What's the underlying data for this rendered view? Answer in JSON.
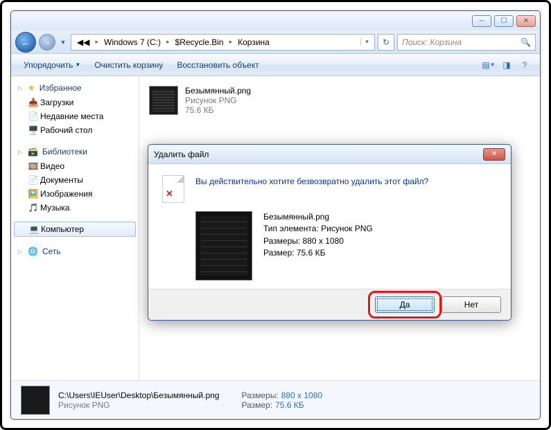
{
  "titlebar": {},
  "nav": {
    "crumbs": [
      "Windows 7 (C:)",
      "$Recycle.Bin",
      "Корзина"
    ],
    "search_placeholder": "Поиск: Корзина"
  },
  "toolbar": {
    "organize": "Упорядочить",
    "empty": "Очистить корзину",
    "restore": "Восстановить объект"
  },
  "sidebar": {
    "favorites": {
      "label": "Избранное",
      "items": [
        "Загрузки",
        "Недавние места",
        "Рабочий стол"
      ]
    },
    "libraries": {
      "label": "Библиотеки",
      "items": [
        "Видео",
        "Документы",
        "Изображения",
        "Музыка"
      ]
    },
    "computer": "Компьютер",
    "network": "Сеть"
  },
  "file": {
    "name": "Безымянный.png",
    "type": "Рисунок PNG",
    "size": "75.6 КБ"
  },
  "details": {
    "path": "C:\\Users\\IEUser\\Desktop\\Безымянный.png",
    "type": "Рисунок PNG",
    "dims_label": "Размеры:",
    "dims": "880 x 1080",
    "size_label": "Размер:",
    "size": "75.6 КБ"
  },
  "dialog": {
    "title": "Удалить файл",
    "question": "Вы действительно хотите безвозвратно удалить этот файл?",
    "file_name": "Безымянный.png",
    "type_line": "Тип элемента: Рисунок PNG",
    "dims_line": "Размеры: 880 x 1080",
    "size_line": "Размер: 75.6 КБ",
    "yes": "Да",
    "no": "Нет"
  }
}
